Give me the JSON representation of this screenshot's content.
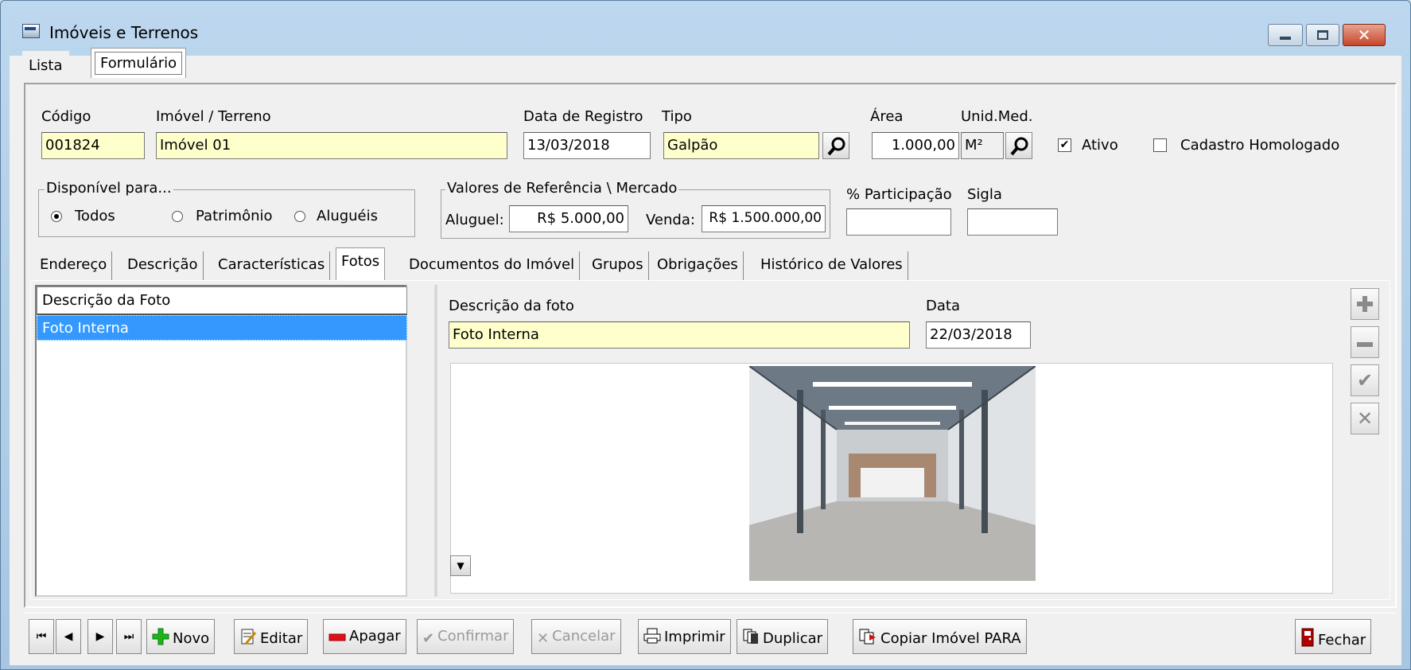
{
  "window": {
    "title": "Imóveis e Terrenos"
  },
  "top_tabs": {
    "lista": "Lista",
    "formulario": "Formulário"
  },
  "header": {
    "codigo_label": "Código",
    "codigo_value": "001824",
    "imovel_label": "Imóvel / Terreno",
    "imovel_value": "Imóvel 01",
    "data_label": "Data de Registro",
    "data_value": "13/03/2018",
    "tipo_label": "Tipo",
    "tipo_value": "Galpão",
    "area_label": "Área",
    "area_value": "1.000,00",
    "unid_label": "Unid.Med.",
    "unid_value": "M²",
    "ativo_label": "Ativo",
    "ativo_checked": true,
    "homologado_label": "Cadastro Homologado",
    "homologado_checked": false
  },
  "disponivel": {
    "title": "Disponível para...",
    "options": [
      "Todos",
      "Patrimônio",
      "Aluguéis"
    ],
    "selected": "Todos"
  },
  "valores": {
    "title": "Valores de Referência \\ Mercado",
    "aluguel_label": "Aluguel:",
    "aluguel_value": "R$ 5.000,00",
    "venda_label": "Venda:",
    "venda_value": "R$ 1.500.000,00"
  },
  "participacao": {
    "label": "% Participação",
    "value": ""
  },
  "sigla": {
    "label": "Sigla",
    "value": ""
  },
  "sub_tabs": [
    "Endereço",
    "Descrição",
    "Características",
    "Fotos",
    "Documentos do Imóvel",
    "Grupos",
    "Obrigações",
    "Histórico de Valores"
  ],
  "active_sub_tab": "Fotos",
  "fotos_list": {
    "header": "Descrição da Foto",
    "rows": [
      "Foto Interna"
    ]
  },
  "foto_detail": {
    "descricao_label": "Descrição da foto",
    "descricao_value": "Foto Interna",
    "data_label": "Data",
    "data_value": "22/03/2018"
  },
  "toolbar": {
    "novo": "Novo",
    "editar": "Editar",
    "apagar": "Apagar",
    "confirmar": "Confirmar",
    "cancelar": "Cancelar",
    "imprimir": "Imprimir",
    "duplicar": "Duplicar",
    "copiar": "Copiar Imóvel PARA",
    "fechar": "Fechar"
  },
  "icons": {
    "side": [
      "plus-icon",
      "minus-icon",
      "check-icon",
      "x-icon"
    ],
    "nav": [
      "first-record-icon",
      "prev-record-icon",
      "next-record-icon",
      "last-record-icon"
    ]
  }
}
